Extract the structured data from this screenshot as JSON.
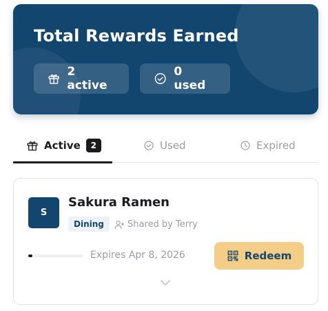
{
  "hero": {
    "title": "Total Rewards Earned",
    "active_chip": "2 active",
    "used_chip": "0 used"
  },
  "tabs": [
    {
      "label": "Active",
      "badge": "2",
      "icon": "gift-icon",
      "selected": true
    },
    {
      "label": "Used",
      "icon": "check-circle-icon",
      "selected": false
    },
    {
      "label": "Expired",
      "icon": "clock-icon",
      "selected": false
    }
  ],
  "reward": {
    "avatar_letter": "S",
    "title": "Sakura Ramen",
    "category": "Dining",
    "shared_by": "Shared by Terry",
    "expires": "Expires Apr 8, 2026",
    "progress_fraction": 0.08,
    "redeem_label": "Redeem"
  },
  "colors": {
    "brand_navy": "#13466f",
    "redeem_gold": "#f4cd86",
    "muted_text": "#9a9ca3"
  }
}
